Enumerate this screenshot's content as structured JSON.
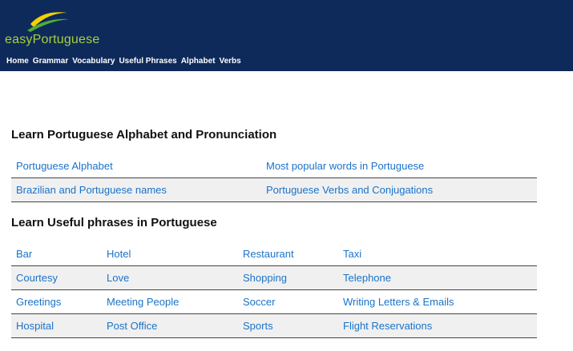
{
  "site": {
    "logo_text": "easyPortuguese"
  },
  "nav": [
    "Home",
    "Grammar",
    "Vocabulary",
    "Useful Phrases",
    "Alphabet",
    "Verbs"
  ],
  "alphabet_section": {
    "title": "Learn Portuguese Alphabet and Pronunciation",
    "rows": [
      [
        "Portuguese Alphabet",
        "Most popular words in Portuguese"
      ],
      [
        "Brazilian and Portuguese names",
        "Portuguese Verbs and Conjugations"
      ]
    ]
  },
  "phrases_section": {
    "title": "Learn Useful phrases in Portuguese",
    "rows": [
      [
        "Bar",
        "Hotel",
        "Restaurant",
        "Taxi"
      ],
      [
        "Courtesy",
        "Love",
        "Shopping",
        "Telephone"
      ],
      [
        "Greetings",
        "Meeting People",
        "Soccer",
        "Writing Letters & Emails"
      ],
      [
        "Hospital",
        "Post Office",
        "Sports",
        "Flight Reservations"
      ]
    ]
  },
  "colors": {
    "header_bg": "#0e2a5a",
    "logo_text": "#a6d13a",
    "link": "#1a73c9",
    "alt_row": "#f0f0f0"
  },
  "icons": {
    "logo": "swoosh-logo-icon"
  }
}
